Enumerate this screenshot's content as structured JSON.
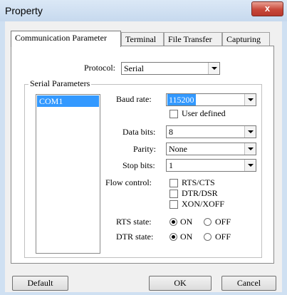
{
  "window": {
    "title": "Property",
    "close_label": "x"
  },
  "tabs": [
    {
      "label": "Communication Parameter",
      "active": true
    },
    {
      "label": "Terminal",
      "active": false
    },
    {
      "label": "File Transfer",
      "active": false
    },
    {
      "label": "Capturing",
      "active": false
    }
  ],
  "protocol": {
    "label": "Protocol:",
    "value": "Serial"
  },
  "serial": {
    "group_label": "Serial Parameters",
    "ports": [
      "COM1"
    ],
    "baud_rate": {
      "label": "Baud rate:",
      "value": "115200"
    },
    "user_defined": {
      "label": "User defined",
      "checked": false
    },
    "data_bits": {
      "label": "Data bits:",
      "value": "8"
    },
    "parity": {
      "label": "Parity:",
      "value": "None"
    },
    "stop_bits": {
      "label": "Stop bits:",
      "value": "1"
    },
    "flow_control": {
      "label": "Flow control:",
      "options": [
        {
          "label": "RTS/CTS",
          "checked": false
        },
        {
          "label": "DTR/DSR",
          "checked": false
        },
        {
          "label": "XON/XOFF",
          "checked": false
        }
      ]
    },
    "rts_state": {
      "label": "RTS state:",
      "on_label": "ON",
      "off_label": "OFF",
      "value": "ON"
    },
    "dtr_state": {
      "label": "DTR state:",
      "on_label": "ON",
      "off_label": "OFF",
      "value": "ON"
    }
  },
  "buttons": {
    "default": "Default",
    "ok": "OK",
    "cancel": "Cancel"
  }
}
